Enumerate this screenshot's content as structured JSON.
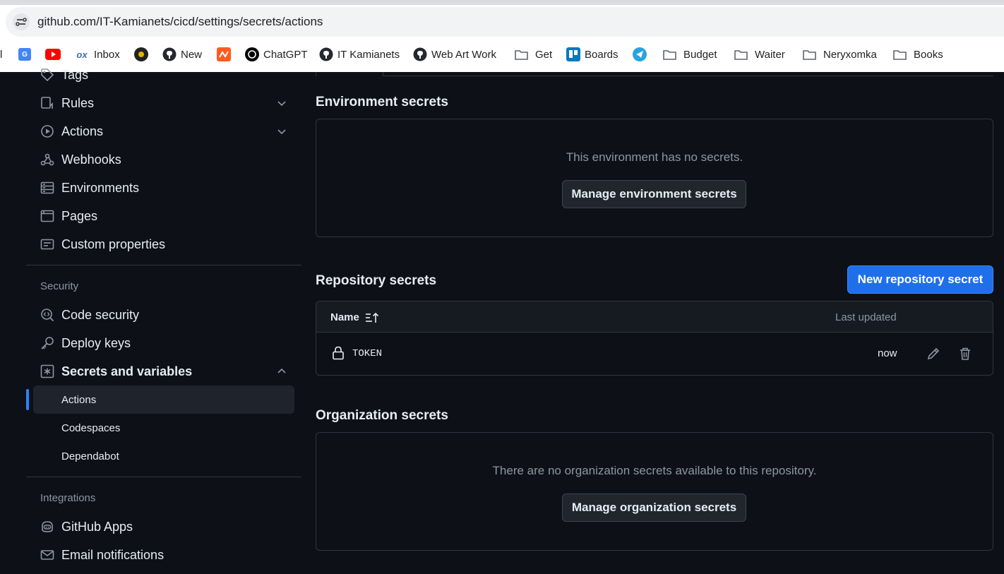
{
  "browser": {
    "url": "github.com/IT-Kamianets/cicd/settings/secrets/actions",
    "bookmarks": [
      {
        "label": "",
        "icon": "google-translate-icon"
      },
      {
        "label": "",
        "icon": "youtube-icon"
      },
      {
        "label": "Inbox",
        "icon": "ox-inbox-icon"
      },
      {
        "label": "",
        "icon": "spider-icon"
      },
      {
        "label": "New",
        "icon": "github-icon"
      },
      {
        "label": "",
        "icon": "orange-app-icon"
      },
      {
        "label": "ChatGPT",
        "icon": "chatgpt-icon"
      },
      {
        "label": "IT Kamianets",
        "icon": "github-icon"
      },
      {
        "label": "Web Art Work",
        "icon": "github-icon"
      },
      {
        "label": "Get",
        "icon": "folder-icon"
      },
      {
        "label": "Boards",
        "icon": "trello-icon"
      },
      {
        "label": "",
        "icon": "telegram-icon"
      },
      {
        "label": "Budget",
        "icon": "folder-icon"
      },
      {
        "label": "Waiter",
        "icon": "folder-icon"
      },
      {
        "label": "Neryxomka",
        "icon": "folder-icon"
      },
      {
        "label": "Books",
        "icon": "folder-icon"
      }
    ]
  },
  "sidebar": {
    "items": [
      {
        "label": "Tags",
        "icon": "tag-icon"
      },
      {
        "label": "Rules",
        "icon": "rules-icon",
        "chevron": "chevron-down-icon"
      },
      {
        "label": "Actions",
        "icon": "play-icon",
        "chevron": "chevron-down-icon"
      },
      {
        "label": "Webhooks",
        "icon": "webhook-icon"
      },
      {
        "label": "Environments",
        "icon": "server-icon"
      },
      {
        "label": "Pages",
        "icon": "browser-icon"
      },
      {
        "label": "Custom properties",
        "icon": "note-icon"
      }
    ],
    "security_heading": "Security",
    "security_items": [
      {
        "label": "Code security",
        "icon": "codescan-icon"
      },
      {
        "label": "Deploy keys",
        "icon": "key-icon"
      },
      {
        "label": "Secrets and variables",
        "icon": "asterisk-icon",
        "chevron": "chevron-up-icon"
      }
    ],
    "secrets_sub": [
      {
        "label": "Actions",
        "active": true
      },
      {
        "label": "Codespaces"
      },
      {
        "label": "Dependabot"
      }
    ],
    "integrations_heading": "Integrations",
    "integrations_items": [
      {
        "label": "GitHub Apps",
        "icon": "copilot-icon"
      },
      {
        "label": "Email notifications",
        "icon": "mail-icon"
      }
    ]
  },
  "main": {
    "env": {
      "title": "Environment secrets",
      "empty": "This environment has no secrets.",
      "button": "Manage environment secrets"
    },
    "repo": {
      "title": "Repository secrets",
      "new_button": "New repository secret",
      "col_name": "Name",
      "col_updated": "Last updated",
      "rows": [
        {
          "name": "TOKEN",
          "updated": "now"
        }
      ]
    },
    "org": {
      "title": "Organization secrets",
      "empty": "There are no organization secrets available to this repository.",
      "button": "Manage organization secrets"
    }
  },
  "colors": {
    "bg": "#0d1117",
    "accent": "#1f6feb",
    "active_indicator": "#2f81f7",
    "border": "#30363d",
    "muted_text": "#8d96a0"
  }
}
